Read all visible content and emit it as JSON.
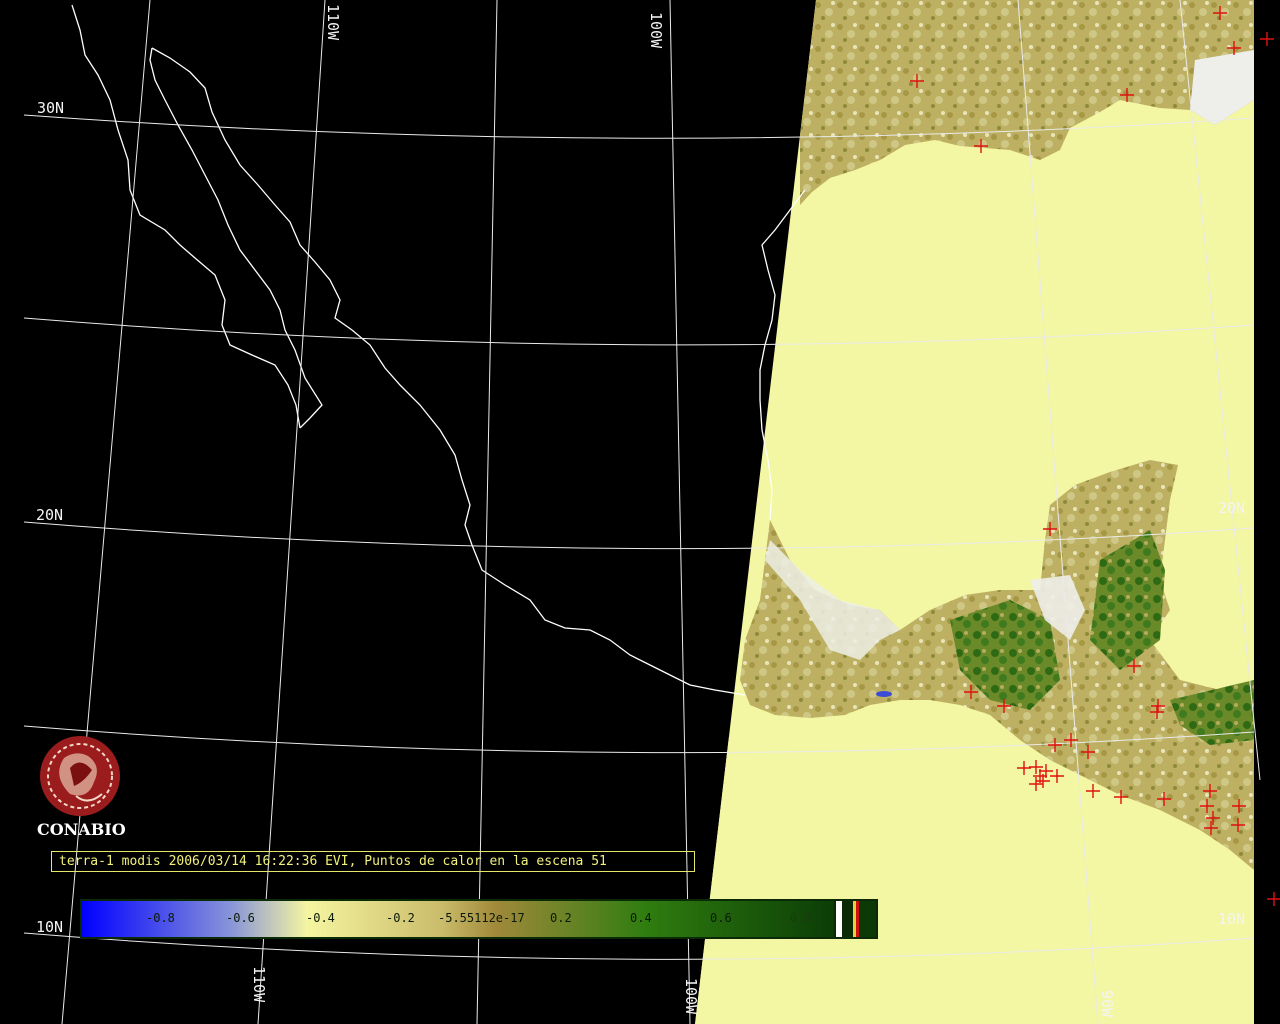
{
  "caption": "terra-1 modis 2006/03/14 16:22:36 EVI, Puntos de calor en la escena 51",
  "logo": {
    "name": "CONABIO",
    "color": "#9b1c1c"
  },
  "grid_labels": {
    "lat_30": "30N",
    "lat_20_left": "20N",
    "lat_20_right": "20N",
    "lat_10_left": "10N",
    "lat_10_right": "10N",
    "lon_110_top": "110W",
    "lon_100_top": "100W",
    "lon_110_bottom": "110W",
    "lon_100_bottom": "100W",
    "lon_90_bottom": "90W"
  },
  "colorbar": {
    "ticks": [
      "-0.8",
      "-0.6",
      "-0.4",
      "-0.2",
      "-5.55112e-17",
      "0.2",
      "0.4",
      "0.6",
      "0.8"
    ],
    "colors": [
      "#0000ff",
      "#9aa6d8",
      "#f5f5a0",
      "#a0893a",
      "#2f7d10",
      "#0b3d06"
    ]
  },
  "colors": {
    "background": "#000000",
    "coastline": "#ffffff",
    "grid": "#f0f0f0",
    "ocean_scene": "#f3f6a2",
    "land_scene": "#b8aa5a",
    "vegetation": "#2f6f16",
    "hotspot": "#e01010"
  },
  "hotspot_marker": "red-plus-icon"
}
